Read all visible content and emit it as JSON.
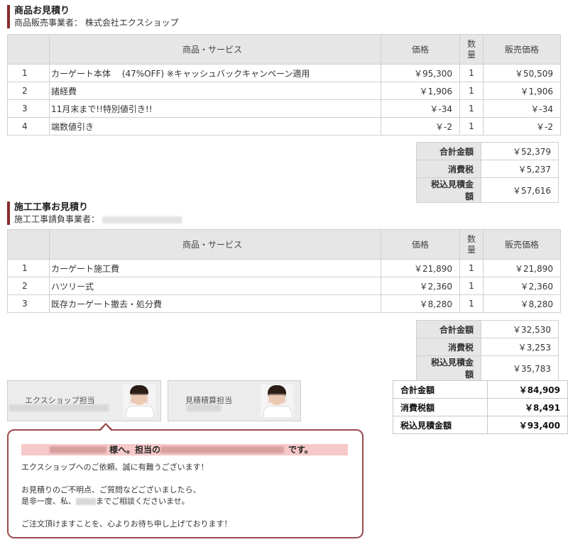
{
  "product_section": {
    "title": "商品お見積り",
    "vendor_label": "商品販売事業者：",
    "vendor_name": "株式会社エクスショップ",
    "headers": {
      "name": "商品・サービス",
      "price": "価格",
      "qty": "数量",
      "sale": "販売価格"
    },
    "rows": [
      {
        "no": "1",
        "name": "カーゲート本体　 (47%OFF) ※キャッシュバックキャンペーン適用",
        "price": "￥95,300",
        "qty": "1",
        "sale": "￥50,509"
      },
      {
        "no": "2",
        "name": "諸経費",
        "price": "￥1,906",
        "qty": "1",
        "sale": "￥1,906"
      },
      {
        "no": "3",
        "name": "11月末まで!!特別値引き!!",
        "price": "￥-34",
        "qty": "1",
        "sale": "￥-34"
      },
      {
        "no": "4",
        "name": "端数値引き",
        "price": "￥-2",
        "qty": "1",
        "sale": "￥-2"
      }
    ],
    "summary": [
      {
        "label": "合計金額",
        "value": "￥52,379"
      },
      {
        "label": "消費税",
        "value": "￥5,237"
      },
      {
        "label": "税込見積金額",
        "value": "￥57,616"
      }
    ]
  },
  "work_section": {
    "title": "施工工事お見積り",
    "vendor_label": "施工工事請負事業者：",
    "headers": {
      "name": "商品・サービス",
      "price": "価格",
      "qty": "数量",
      "sale": "販売価格"
    },
    "rows": [
      {
        "no": "1",
        "name": "カーゲート施工費",
        "price": "￥21,890",
        "qty": "1",
        "sale": "￥21,890"
      },
      {
        "no": "2",
        "name": "ハツリー式",
        "price": "￥2,360",
        "qty": "1",
        "sale": "￥2,360"
      },
      {
        "no": "3",
        "name": "既存カーゲート撤去・処分費",
        "price": "￥8,280",
        "qty": "1",
        "sale": "￥8,280"
      }
    ],
    "summary": [
      {
        "label": "合計金額",
        "value": "￥32,530"
      },
      {
        "label": "消費税",
        "value": "￥3,253"
      },
      {
        "label": "税込見積金額",
        "value": "￥35,783"
      }
    ]
  },
  "grand_total": [
    {
      "label": "合計金額",
      "value": "￥84,909"
    },
    {
      "label": "消費税額",
      "value": "￥8,491"
    },
    {
      "label": "税込見積金額",
      "value": "￥93,400"
    }
  ],
  "staff": {
    "exshop_label": "エクスショップ担当",
    "estimator_label": "見積積算担当"
  },
  "message": {
    "greet_suffix": "様へ。担当の",
    "greet_end": "です。",
    "line1": "エクスショップへのご依頼、誠に有難うございます！",
    "line2": "お見積りのご不明点、ご質問などございましたら、",
    "line3_a": "是非一度、私、",
    "line3_b": "までご相談くださいませ。",
    "line4": "ご注文頂けますことを、心よりお待ち申し上げております！"
  }
}
